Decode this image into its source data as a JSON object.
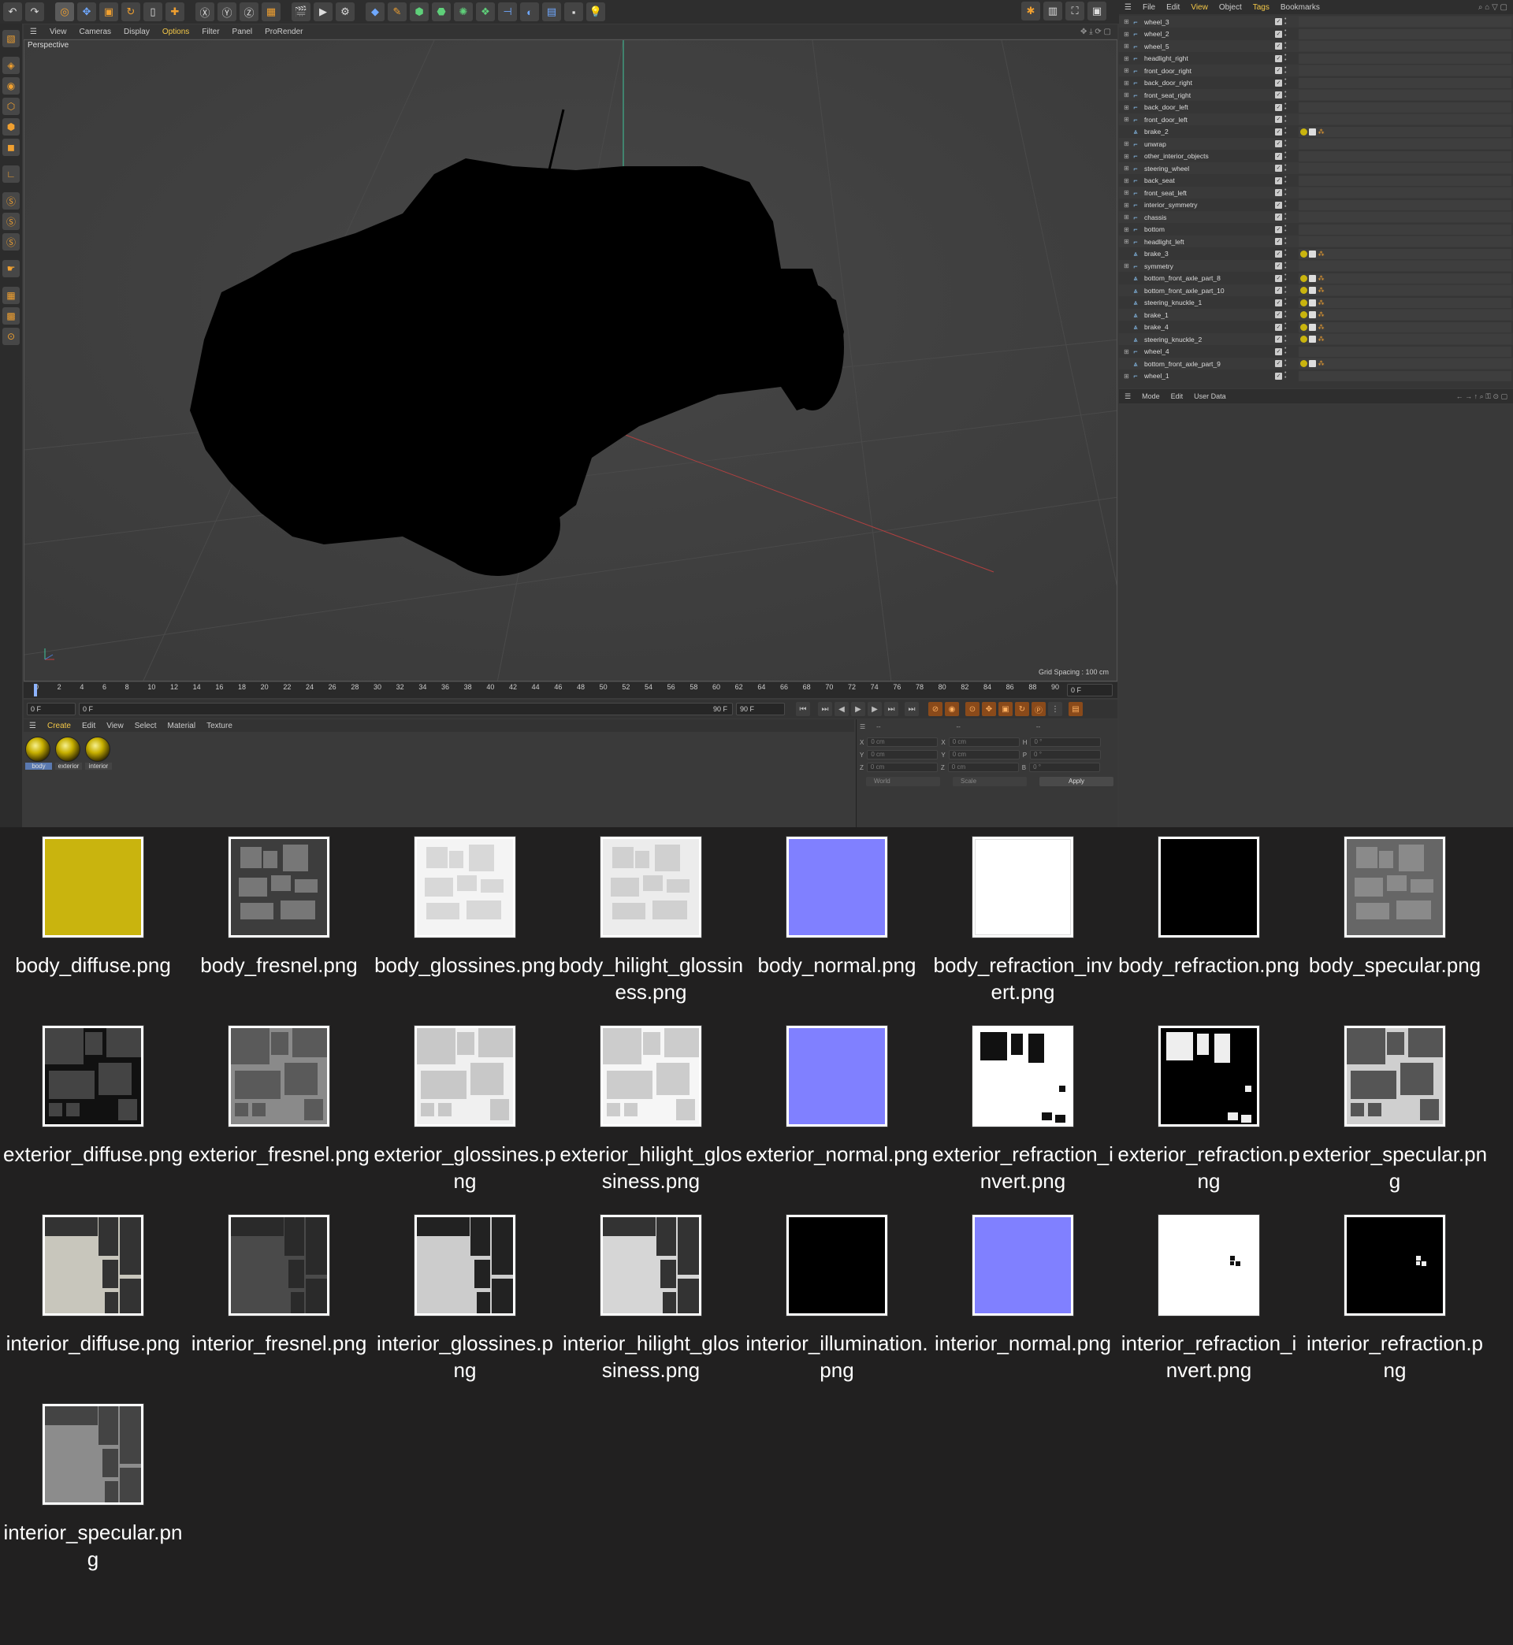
{
  "viewport_menu": [
    "View",
    "Cameras",
    "Display",
    "Options",
    "Filter",
    "Panel",
    "ProRender"
  ],
  "viewport_label": "Perspective",
  "grid_spacing": "Grid Spacing : 100 cm",
  "timeline": {
    "ticks": [
      "0",
      "2",
      "4",
      "6",
      "8",
      "10",
      "12",
      "14",
      "16",
      "18",
      "20",
      "22",
      "24",
      "26",
      "28",
      "30",
      "32",
      "34",
      "36",
      "38",
      "40",
      "42",
      "44",
      "46",
      "48",
      "50",
      "52",
      "54",
      "56",
      "58",
      "60",
      "62",
      "64",
      "66",
      "68",
      "70",
      "72",
      "74",
      "76",
      "78",
      "80",
      "82",
      "84",
      "86",
      "88",
      "90"
    ],
    "current_frame": "0 F",
    "start_field": "0 F",
    "start_field2": "0 F",
    "end_label": "90 F",
    "end_field": "90 F"
  },
  "material_menu": [
    "Create",
    "Edit",
    "View",
    "Select",
    "Material",
    "Texture"
  ],
  "materials": [
    "body",
    "exterior",
    "interior"
  ],
  "coordinates": {
    "header": [
      "--",
      "--",
      "--"
    ],
    "rows": [
      {
        "a": "X",
        "av": "0 cm",
        "b": "X",
        "bv": "0 cm",
        "c": "H",
        "cv": "0 °"
      },
      {
        "a": "Y",
        "av": "0 cm",
        "b": "Y",
        "bv": "0 cm",
        "c": "P",
        "cv": "0 °"
      },
      {
        "a": "Z",
        "av": "0 cm",
        "b": "Z",
        "bv": "0 cm",
        "c": "B",
        "cv": "0 °"
      }
    ],
    "world": "World",
    "scale": "Scale",
    "apply": "Apply"
  },
  "object_menu": [
    "File",
    "Edit",
    "View",
    "Object",
    "Tags",
    "Bookmarks"
  ],
  "objects": [
    {
      "name": "wheel_3",
      "type": "null",
      "tags": false
    },
    {
      "name": "wheel_2",
      "type": "null",
      "tags": false
    },
    {
      "name": "wheel_5",
      "type": "null",
      "tags": false
    },
    {
      "name": "headlight_right",
      "type": "null",
      "tags": false
    },
    {
      "name": "front_door_right",
      "type": "null",
      "tags": false
    },
    {
      "name": "back_door_right",
      "type": "null",
      "tags": false
    },
    {
      "name": "front_seat_right",
      "type": "null",
      "tags": false
    },
    {
      "name": "back_door_left",
      "type": "null",
      "tags": false
    },
    {
      "name": "front_door_left",
      "type": "null",
      "tags": false
    },
    {
      "name": "brake_2",
      "type": "mesh",
      "tags": true
    },
    {
      "name": "unwrap",
      "type": "null",
      "tags": false
    },
    {
      "name": "other_interior_objects",
      "type": "null",
      "tags": false
    },
    {
      "name": "steering_wheel",
      "type": "null",
      "tags": false
    },
    {
      "name": "back_seat",
      "type": "null",
      "tags": false
    },
    {
      "name": "front_seat_left",
      "type": "null",
      "tags": false
    },
    {
      "name": "interior_symmetry",
      "type": "null",
      "tags": false
    },
    {
      "name": "chassis",
      "type": "null",
      "tags": false
    },
    {
      "name": "bottom",
      "type": "null",
      "tags": false
    },
    {
      "name": "headlight_left",
      "type": "null",
      "tags": false
    },
    {
      "name": "brake_3",
      "type": "mesh",
      "tags": true
    },
    {
      "name": "symmetry",
      "type": "null",
      "tags": false
    },
    {
      "name": "bottom_front_axle_part_8",
      "type": "mesh",
      "tags": true
    },
    {
      "name": "bottom_front_axle_part_10",
      "type": "mesh",
      "tags": true
    },
    {
      "name": "steering_knuckle_1",
      "type": "mesh",
      "tags": true
    },
    {
      "name": "brake_1",
      "type": "mesh",
      "tags": true
    },
    {
      "name": "brake_4",
      "type": "mesh",
      "tags": true
    },
    {
      "name": "steering_knuckle_2",
      "type": "mesh",
      "tags": true
    },
    {
      "name": "wheel_4",
      "type": "null",
      "tags": false
    },
    {
      "name": "bottom_front_axle_part_9",
      "type": "mesh",
      "tags": true
    },
    {
      "name": "wheel_1",
      "type": "null",
      "tags": false
    }
  ],
  "attr_menu": [
    "Mode",
    "Edit",
    "User Data"
  ],
  "files": [
    {
      "name": "body_diffuse.png",
      "kind": "solid",
      "color": "#c9b40e"
    },
    {
      "name": "body_fresnel.png",
      "kind": "uv",
      "base": "#3d3d3d",
      "fg": "#777777"
    },
    {
      "name": "body_glossines.png",
      "kind": "uv",
      "base": "#f4f4f4",
      "fg": "#d8d8d8"
    },
    {
      "name": "body_hilight_glossiness.png",
      "kind": "uv",
      "base": "#ececec",
      "fg": "#d0d0d0"
    },
    {
      "name": "body_normal.png",
      "kind": "solid",
      "color": "#8080ff"
    },
    {
      "name": "body_refraction_invert.png",
      "kind": "solid",
      "color": "#ffffff"
    },
    {
      "name": "body_refraction.png",
      "kind": "solid",
      "color": "#000000"
    },
    {
      "name": "body_specular.png",
      "kind": "uv",
      "base": "#666666",
      "fg": "#8a8a8a"
    },
    {
      "name": "exterior_diffuse.png",
      "kind": "ext",
      "base": "#111111",
      "fg": "#444444"
    },
    {
      "name": "exterior_fresnel.png",
      "kind": "ext",
      "base": "#8a8a8a",
      "fg": "#5a5a5a"
    },
    {
      "name": "exterior_glossines.png",
      "kind": "ext",
      "base": "#f0f0f0",
      "fg": "#c8c8c8"
    },
    {
      "name": "exterior_hilight_glossiness.png",
      "kind": "ext",
      "base": "#f6f6f6",
      "fg": "#cccccc"
    },
    {
      "name": "exterior_normal.png",
      "kind": "solid",
      "color": "#8080ff"
    },
    {
      "name": "exterior_refraction_invert.png",
      "kind": "ref",
      "base": "#ffffff",
      "fg": "#111111"
    },
    {
      "name": "exterior_refraction.png",
      "kind": "ref",
      "base": "#000000",
      "fg": "#eeeeee"
    },
    {
      "name": "exterior_specular.png",
      "kind": "ext",
      "base": "#cfcfcf",
      "fg": "#555555"
    },
    {
      "name": "interior_diffuse.png",
      "kind": "int",
      "base": "#c8c6bc",
      "fg": "#333333"
    },
    {
      "name": "interior_fresnel.png",
      "kind": "int",
      "base": "#4a4a4a",
      "fg": "#2a2a2a"
    },
    {
      "name": "interior_glossines.png",
      "kind": "int",
      "base": "#cccccc",
      "fg": "#222222"
    },
    {
      "name": "interior_hilight_glossiness.png",
      "kind": "int",
      "base": "#d6d6d6",
      "fg": "#333333"
    },
    {
      "name": "interior_illumination.png",
      "kind": "solid",
      "color": "#000000"
    },
    {
      "name": "interior_normal.png",
      "kind": "solid",
      "color": "#8080ff"
    },
    {
      "name": "interior_refraction_invert.png",
      "kind": "dots",
      "base": "#ffffff",
      "fg": "#111111"
    },
    {
      "name": "interior_refraction.png",
      "kind": "dots",
      "base": "#000000",
      "fg": "#eeeeee"
    },
    {
      "name": "interior_specular.png",
      "kind": "int",
      "base": "#8c8c8c",
      "fg": "#444444"
    }
  ]
}
